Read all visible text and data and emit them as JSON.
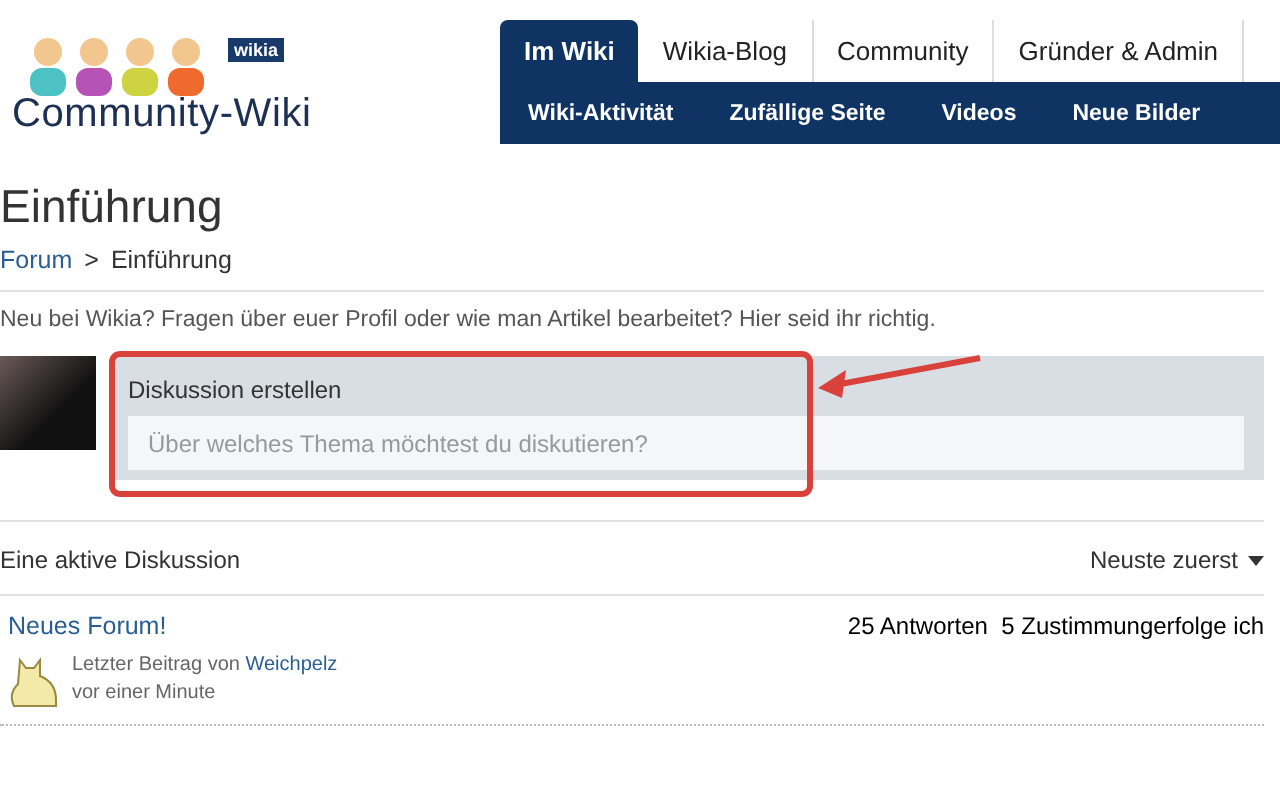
{
  "logo": {
    "badge": "wikia",
    "name": "Community-Wiki"
  },
  "nav": {
    "tabs": [
      {
        "label": "Im Wiki",
        "selected": true
      },
      {
        "label": "Wikia-Blog",
        "selected": false
      },
      {
        "label": "Community",
        "selected": false
      },
      {
        "label": "Gründer & Admin",
        "selected": false
      }
    ],
    "subnav": [
      "Wiki-Aktivität",
      "Zufällige Seite",
      "Videos",
      "Neue Bilder"
    ]
  },
  "page": {
    "title": "Einführung",
    "breadcrumb": {
      "link": "Forum",
      "separator": ">",
      "current": "Einführung"
    },
    "intro": "Neu bei Wikia? Fragen über euer Profil oder wie man Artikel bearbeitet? Hier seid ihr richtig."
  },
  "composer": {
    "label": "Diskussion erstellen",
    "placeholder": "Über welches Thema möchtest du diskutieren?"
  },
  "list": {
    "heading": "Eine aktive Diskussion",
    "sort": "Neuste zuerst",
    "threads": [
      {
        "title": "Neues Forum!",
        "stats": "25 Antworten  5 Zustimmungerfolge ich",
        "last_prefix": "Letzter Beitrag von",
        "author": "Weichpelz",
        "time": "vor einer Minute"
      }
    ]
  }
}
